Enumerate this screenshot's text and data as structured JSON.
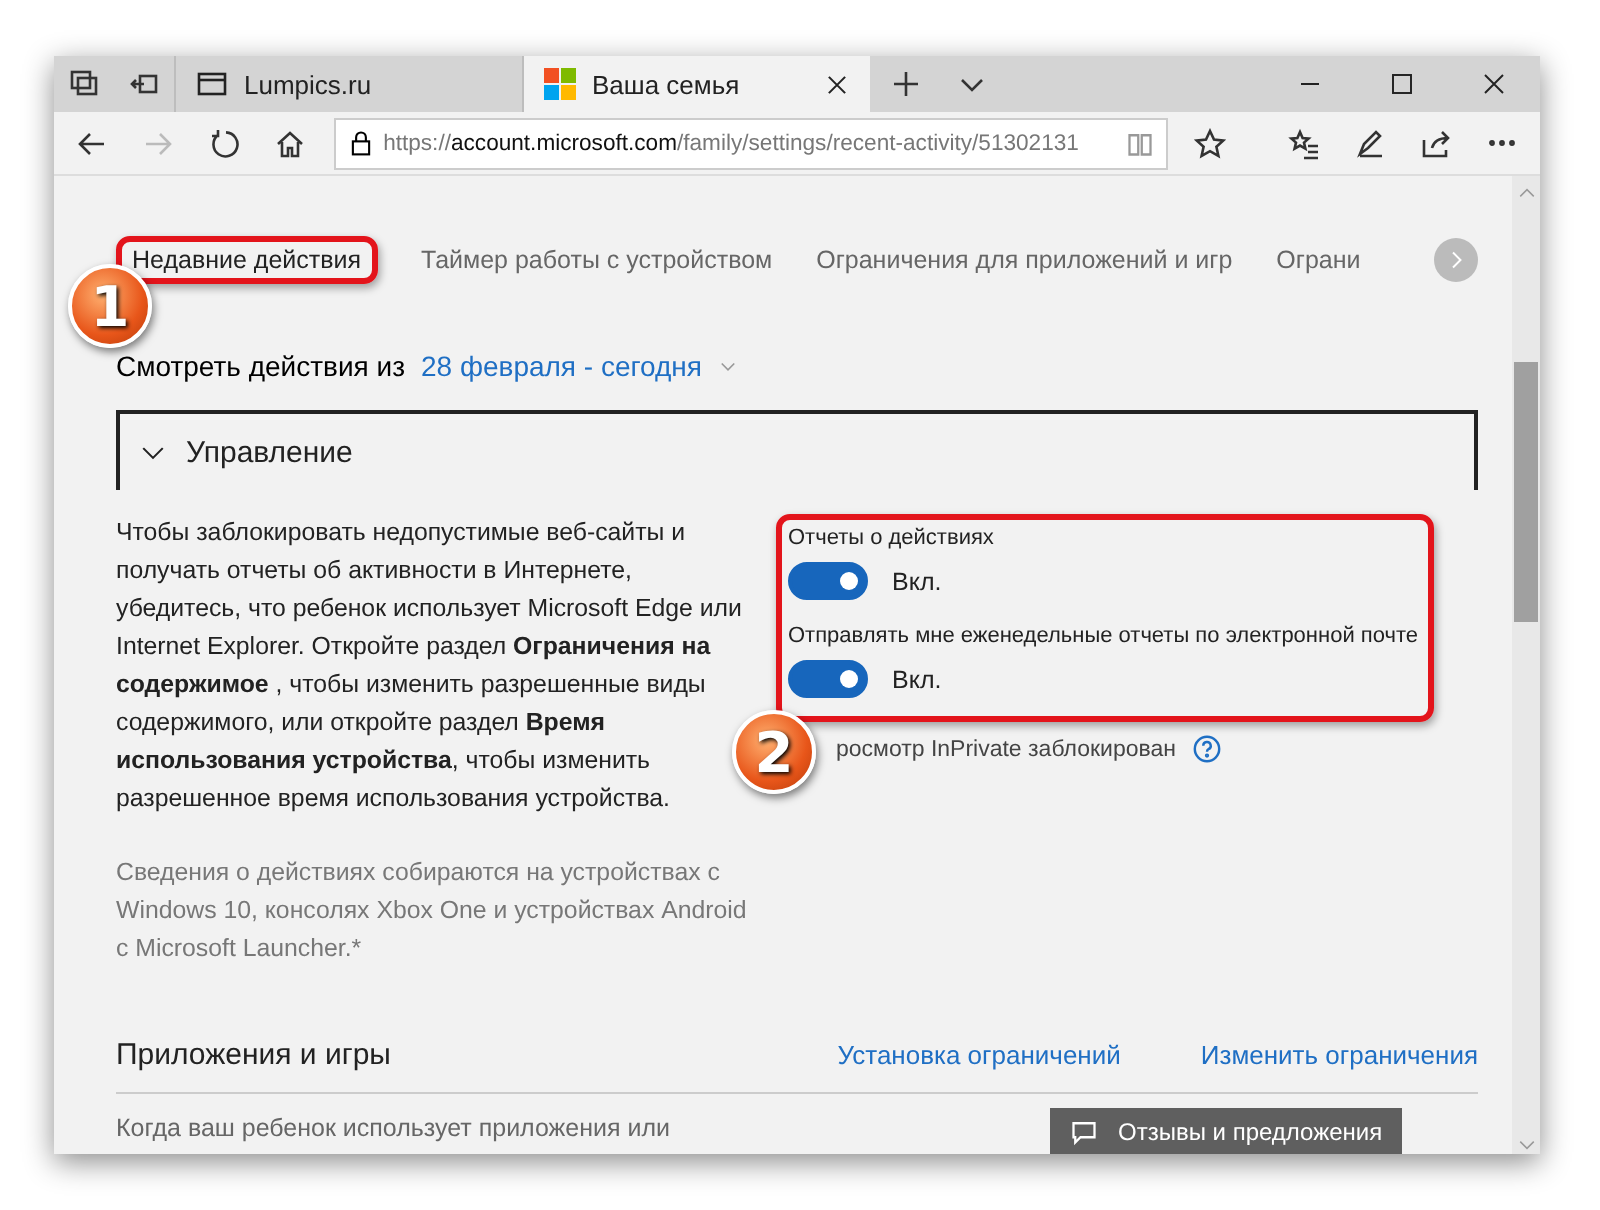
{
  "browser": {
    "tabs": [
      {
        "title": "Lumpics.ru",
        "selected": false
      },
      {
        "title": "Ваша семья",
        "selected": true
      }
    ],
    "address": {
      "scheme": "https://",
      "host": "account.microsoft.com",
      "path": "/family/settings/recent-activity/51302131"
    }
  },
  "nav_tabs": [
    {
      "label": "Недавние действия",
      "selected": true
    },
    {
      "label": "Таймер работы с устройством",
      "selected": false
    },
    {
      "label": "Ограничения для приложений и игр",
      "selected": false
    },
    {
      "label": "Ограни",
      "selected": false
    }
  ],
  "view_from": {
    "label": "Смотреть действия из",
    "value": "28 февраля - сегодня"
  },
  "management": {
    "title": "Управление",
    "expanded": true,
    "description": "Чтобы заблокировать недопустимые веб-сайты и получать отчеты об активности в Интернете, убедитесь, что ребенок использует Microsoft Edge или Internet Explorer. Откройте раздел **Ограничения на содержимое** , чтобы изменить разрешенные виды содержимого, или откройте раздел **Время использования устройства**, чтобы изменить разрешенное время использования устройства.",
    "note": "Сведения о действиях собираются на устройствах с Windows 10, консолях Xbox One и устройствах Android с Microsoft Launcher.*",
    "settings": [
      {
        "kind": "toggle",
        "label": "Отчеты о действиях",
        "on": true,
        "state_text": "Вкл."
      },
      {
        "kind": "toggle",
        "label": "Отправлять мне еженедельные отчеты по электронной почте",
        "on": true,
        "state_text": "Вкл."
      },
      {
        "kind": "info",
        "label": "росмотр InPrivate заблокирован"
      }
    ]
  },
  "apps_section": {
    "title": "Приложения и игры",
    "links": [
      "Установка ограничений",
      "Изменить ограничения"
    ],
    "text": "Когда ваш ребенок использует приложения или"
  },
  "feedback_button": "Отзывы и предложения",
  "annotations": [
    {
      "number": "1"
    },
    {
      "number": "2"
    }
  ]
}
